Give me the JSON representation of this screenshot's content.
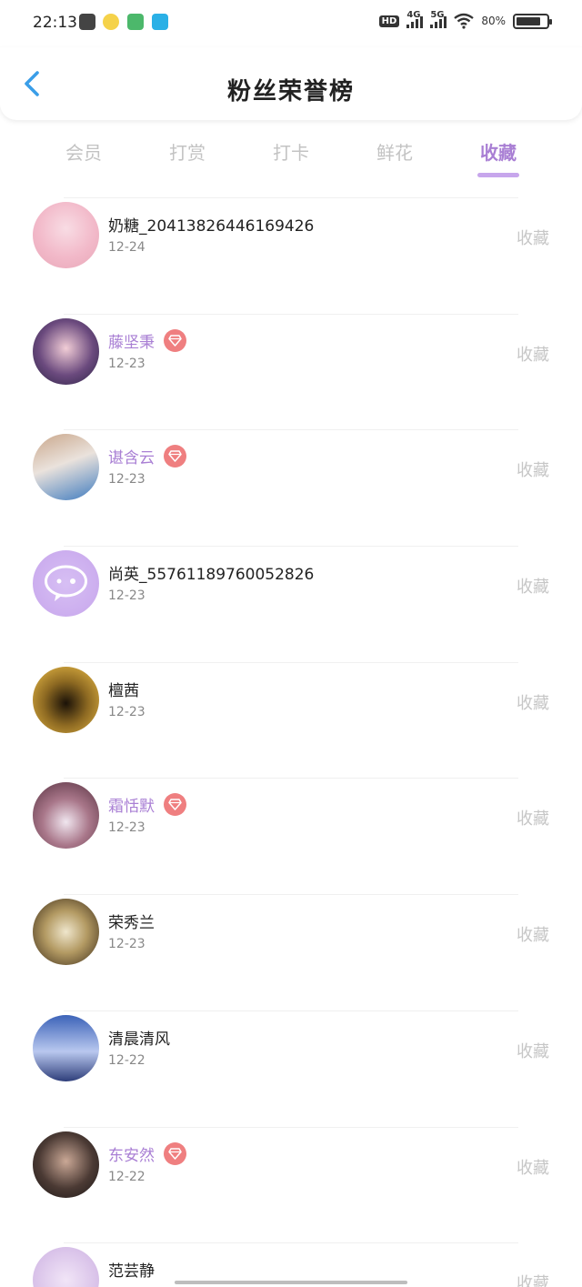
{
  "status_bar": {
    "time": "22:13",
    "hd": "HD",
    "sim1": "4G",
    "sim2": "5G",
    "battery": "80%",
    "battery_level": 0.8
  },
  "header": {
    "title": "粉丝荣誉榜",
    "back_icon": "chevron-left-icon"
  },
  "tabs": [
    {
      "label": "会员"
    },
    {
      "label": "打赏"
    },
    {
      "label": "打卡"
    },
    {
      "label": "鲜花"
    },
    {
      "label": "收藏"
    }
  ],
  "active_tab": 4,
  "colors": {
    "accent": "#a97fd4",
    "underline": "#c7a6ec",
    "vip_badge": "#ef7f80",
    "muted": "#c6c6c6",
    "back": "#3a9ee8"
  },
  "fans": [
    {
      "name": "奶糖_20413826446169426",
      "date": "12-24",
      "vip": false,
      "action": "收藏"
    },
    {
      "name": "藤坚秉",
      "date": "12-23",
      "vip": true,
      "action": "收藏"
    },
    {
      "name": "谌含云",
      "date": "12-23",
      "vip": true,
      "action": "收藏"
    },
    {
      "name": "尚英_55761189760052826",
      "date": "12-23",
      "vip": false,
      "action": "收藏"
    },
    {
      "name": "檀茜",
      "date": "12-23",
      "vip": false,
      "action": "收藏"
    },
    {
      "name": "霜恬默",
      "date": "12-23",
      "vip": true,
      "action": "收藏"
    },
    {
      "name": "荣秀兰",
      "date": "12-23",
      "vip": false,
      "action": "收藏"
    },
    {
      "name": "清晨清风",
      "date": "12-22",
      "vip": false,
      "action": "收藏"
    },
    {
      "name": "东安然",
      "date": "12-22",
      "vip": true,
      "action": "收藏"
    },
    {
      "name": "范芸静",
      "date": "",
      "vip": false,
      "action": "收藏"
    }
  ]
}
